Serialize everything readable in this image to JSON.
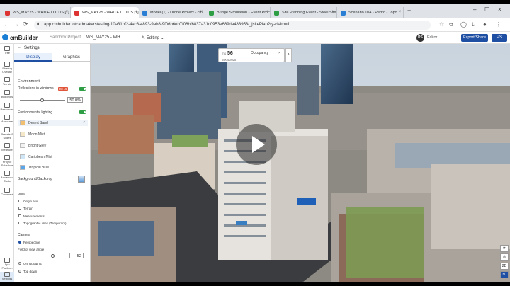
{
  "browser": {
    "tabs": [
      {
        "label": "WS_MAY25 - WHITE LOTUS [1]",
        "active": false
      },
      {
        "label": "WS_MAY25 - WHITE LOTUS [1]",
        "active": true
      },
      {
        "label": "Model (1) - Drone Project - cm",
        "active": false
      },
      {
        "label": "Bridge Simulation - Event Proc",
        "active": false
      },
      {
        "label": "Site Planning Event - Steel Sim",
        "active": false
      },
      {
        "label": "Scenario 104 - Pedro - Topo",
        "active": false
      }
    ],
    "url": "app.cmbuilder.io/cadmakerstesting/10a31bf2-4ac8-4893-9ab8-9f06b6eb7f06b/6837a31c0953e669da483953/_jsitePlan?ry-claim=1"
  },
  "app": {
    "logo": "cmBuilder",
    "breadcrumb": "Sandbox Project",
    "project_title": "WS_MAY25 - WH...",
    "mode": "Editing",
    "user_initials": "PS",
    "role": "Editor",
    "share_label": "Export/Share",
    "menu_initials": "PS"
  },
  "rail": [
    {
      "label": "Tree",
      "icon": "tree-icon"
    },
    {
      "label": "Sharing Overlay",
      "icon": "overlay-icon"
    },
    {
      "label": "Terrain",
      "icon": "terrain-icon"
    },
    {
      "label": "Buildings",
      "icon": "buildings-icon"
    },
    {
      "label": "Resources",
      "icon": "resources-icon"
    },
    {
      "label": "Annotate",
      "icon": "annotate-icon"
    },
    {
      "label": "Presets & Slides",
      "icon": "slides-icon"
    },
    {
      "label": "Measure",
      "icon": "measure-icon"
    },
    {
      "label": "Project Schedule",
      "icon": "schedule-icon"
    },
    {
      "label": "Advanced Tools",
      "icon": "tools-icon"
    },
    {
      "label": "Comment",
      "icon": "comment-icon"
    },
    {
      "label": "App Platform",
      "icon": "platform-icon"
    },
    {
      "label": "Settings",
      "icon": "settings-icon"
    }
  ],
  "settings": {
    "title": "Settings",
    "tabs": [
      "Display",
      "Graphics"
    ],
    "environment_label": "Environment",
    "reflections_label": "Reflections in windows",
    "beta_label": "BETA",
    "reflection_value": "50.0%",
    "lighting_label": "Environmental lighting",
    "presets": [
      {
        "label": "Desert Sand",
        "color": "#f0c070",
        "selected": true
      },
      {
        "label": "Moon Mist",
        "color": "#f4e8c8",
        "selected": false
      },
      {
        "label": "Bright Grey",
        "color": "#f2f2f2",
        "selected": false
      },
      {
        "label": "Caribbean Mist",
        "color": "#cfe6f7",
        "selected": false
      },
      {
        "label": "Tropical Blue",
        "color": "#5aa6e8",
        "selected": false
      }
    ],
    "backdrop_label": "Background/Backdrop",
    "view_label": "View",
    "view_options": [
      "Origin axis",
      "Terrain",
      "Measurements",
      "Topographic lines (Temporary)"
    ],
    "camera_label": "Camera",
    "perspective_label": "Perspective",
    "fov_label": "Field of view angle",
    "fov_value": "52",
    "orthographic_label": "Orthographic",
    "topdown_label": "Top down"
  },
  "viewport": {
    "day_prefix": "ms",
    "day_number": "56",
    "date": "05/04/2025",
    "occupancy_label": "Occupancy",
    "close_symbol": "×",
    "next_symbol": "›",
    "controls": [
      "⟳",
      "◎",
      "2D",
      "3D"
    ]
  }
}
